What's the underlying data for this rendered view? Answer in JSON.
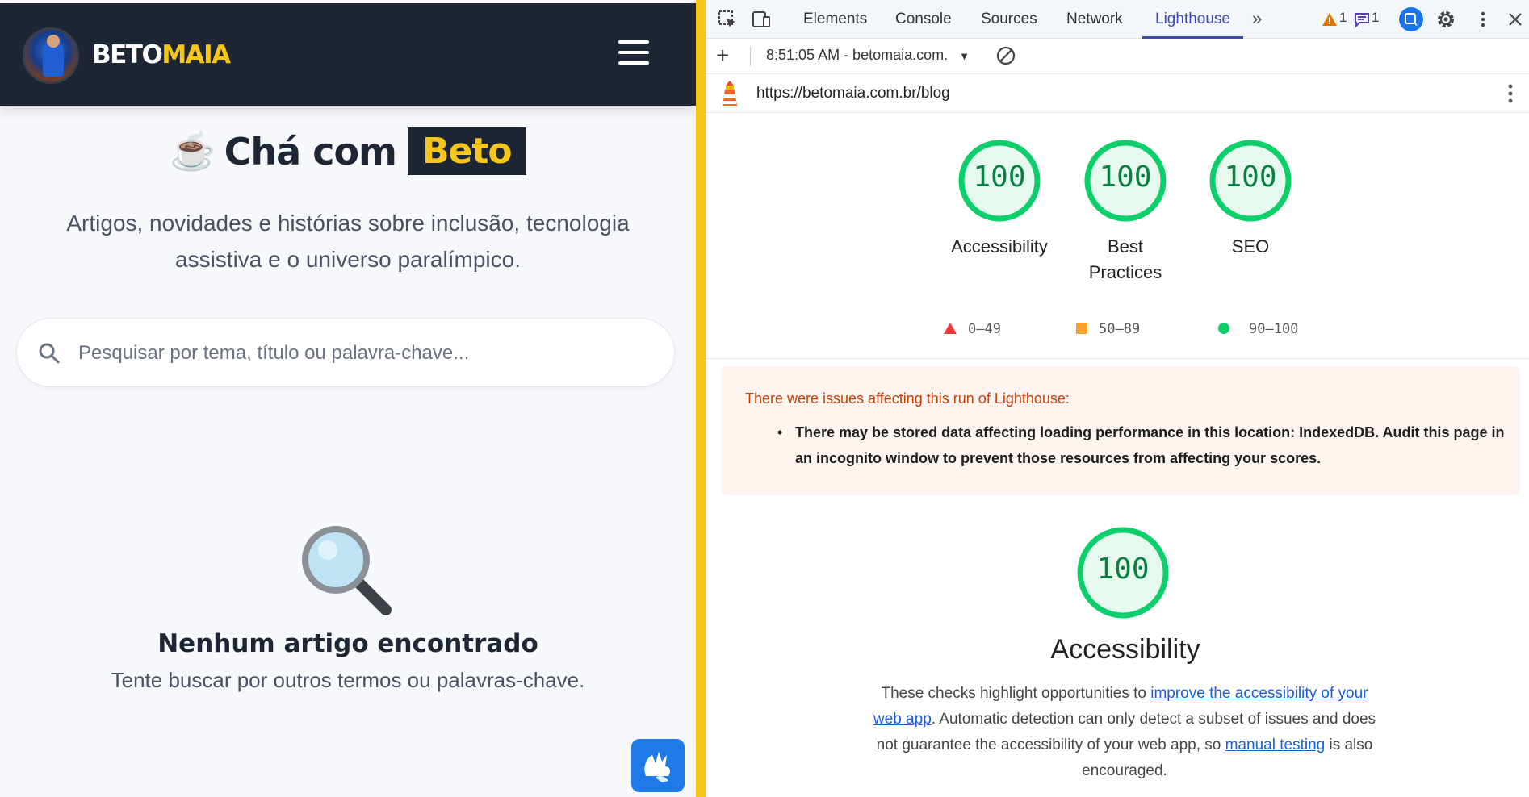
{
  "site": {
    "brand_left": "BETO",
    "brand_right": "MAIA",
    "hero_cup": "☕",
    "hero_title": "Chá com",
    "hero_badge": "Beto",
    "hero_subtitle": "Artigos, novidades e histórias sobre inclusão, tecnologia assistiva e o universo paralímpico.",
    "search_placeholder": "Pesquisar por tema, título ou palavra-chave...",
    "empty_title": "Nenhum artigo encontrado",
    "empty_subtitle": "Tente buscar por outros termos ou palavras-chave.",
    "colors": {
      "header": "#1e2636",
      "accent": "#f6c619",
      "vlibras": "#1e7ae6"
    }
  },
  "devtools": {
    "tabs": [
      {
        "label": "Elements"
      },
      {
        "label": "Console"
      },
      {
        "label": "Sources"
      },
      {
        "label": "Network"
      },
      {
        "label": "Lighthouse",
        "active": true
      }
    ],
    "more_tabs": "»",
    "warnings_count": "1",
    "messages_count": "1",
    "report_select": "8:51:05 AM - betomaia.com.",
    "url": "https://betomaia.com.br/blog",
    "scores": [
      {
        "score": "100",
        "label": "Accessibility"
      },
      {
        "score": "100",
        "label": "Best Practices"
      },
      {
        "score": "100",
        "label": "SEO"
      }
    ],
    "legend": [
      {
        "range": "0–49",
        "shape": "triangle",
        "color": "#eb3a34"
      },
      {
        "range": "50–89",
        "shape": "square",
        "color": "#f8a12f"
      },
      {
        "range": "90–100",
        "shape": "circle",
        "color": "#0cce6b"
      }
    ],
    "warning_title": "There were issues affecting this run of Lighthouse:",
    "warning_item": "There may be stored data affecting loading performance in this location: IndexedDB. Audit this page in an incognito window to prevent those resources from affecting your scores.",
    "category": {
      "score": "100",
      "title": "Accessibility",
      "desc_1": "These checks highlight opportunities to ",
      "link_1": "improve the accessibility of your web app",
      "desc_2": ". Automatic detection can only detect a subset of issues and does not guarantee the accessibility of your web app, so ",
      "link_2": "manual testing",
      "desc_3": " is also encouraged."
    },
    "colors": {
      "score_pass": "#0cce6b",
      "score_text": "#0b8043",
      "active_tab": "#3c4bb5",
      "link": "#1a5ed8"
    }
  }
}
